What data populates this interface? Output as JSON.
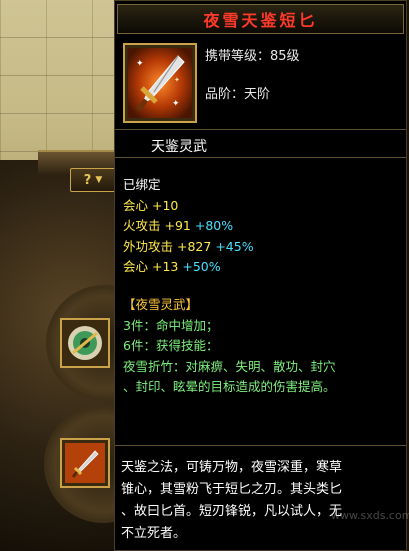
{
  "item": {
    "name": "夜雪天鉴短匕",
    "carry_level_label": "携带等级：",
    "carry_level_value": "85级",
    "grade_label": "品阶：",
    "grade_value": "天阶",
    "section_name": "天鉴灵武"
  },
  "stats": {
    "bound": "已绑定",
    "lines": [
      {
        "name": "会心",
        "base": "+10",
        "extra": ""
      },
      {
        "name": "火攻击",
        "base": "+91",
        "extra": "+80%"
      },
      {
        "name": "外功攻击",
        "base": "+827",
        "extra": "+45%"
      },
      {
        "name": "会心",
        "base": "+13",
        "extra": "+50%"
      }
    ]
  },
  "set": {
    "title": "【夜雪灵武】",
    "pieces3": "3件：命中增加；",
    "pieces6": "6件：获得技能：",
    "skill_line1": "夜雪折竹：对麻痹、失明、散功、封穴",
    "skill_line2": "、封印、眩晕的目标造成的伤害提高。"
  },
  "lore": {
    "line1": "天鉴之法，可铸万物，夜雪深重，寒草",
    "line2": "锥心，其雪粉飞于短匕之刃。其头类匕",
    "line3": "、故曰匕首。短刃锋锐，凡以试人，无",
    "line4": "不立死者。"
  },
  "ui": {
    "help_label": "?",
    "watermark": "www.sxds.com"
  },
  "colors": {
    "title": "#ff3a2a",
    "attr_yellow": "#ffe84a",
    "attr_bonus": "#47e0ff",
    "set_green": "#7ef07e",
    "set_title": "#ffc73a",
    "frame_gold": "#c9a24a"
  }
}
